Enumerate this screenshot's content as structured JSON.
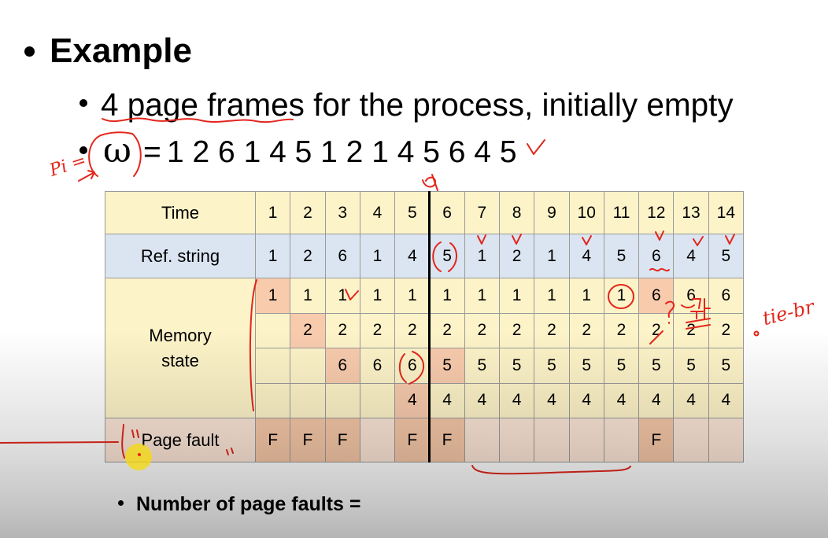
{
  "slide": {
    "heading": "Example",
    "bullet_frames": "4 page frames for the process, initially empty",
    "omega_symbol": "ω",
    "omega_equals": "=",
    "reference_string": "1 2 6 1 4 5 1 2 1 4 5 6 4 5",
    "question": "Number of page faults ="
  },
  "table": {
    "time_label": "Time",
    "times": [
      "1",
      "2",
      "3",
      "4",
      "5",
      "6",
      "7",
      "8",
      "9",
      "10",
      "11",
      "12",
      "13",
      "14"
    ],
    "ref_label": "Ref. string",
    "refs": [
      "1",
      "2",
      "6",
      "1",
      "4",
      "5",
      "1",
      "2",
      "1",
      "4",
      "5",
      "6",
      "4",
      "5"
    ],
    "memory_label": "Memory state",
    "frames": [
      [
        "1",
        "1",
        "1",
        "1",
        "1",
        "1",
        "1",
        "1",
        "1",
        "1",
        "1",
        "6",
        "6",
        "6"
      ],
      [
        "",
        "2",
        "2",
        "2",
        "2",
        "2",
        "2",
        "2",
        "2",
        "2",
        "2",
        "2",
        "2",
        "2"
      ],
      [
        "",
        "",
        "6",
        "6",
        "6",
        "5",
        "5",
        "5",
        "5",
        "5",
        "5",
        "5",
        "5",
        "5"
      ],
      [
        "",
        "",
        "",
        "",
        "4",
        "4",
        "4",
        "4",
        "4",
        "4",
        "4",
        "4",
        "4",
        "4"
      ]
    ],
    "loaded": [
      [
        1,
        0,
        0,
        0,
        0,
        0,
        0,
        0,
        0,
        0,
        0,
        1,
        0,
        0
      ],
      [
        0,
        1,
        0,
        0,
        0,
        0,
        0,
        0,
        0,
        0,
        0,
        0,
        0,
        0
      ],
      [
        0,
        0,
        1,
        0,
        0,
        1,
        0,
        0,
        0,
        0,
        0,
        0,
        0,
        0
      ],
      [
        0,
        0,
        0,
        0,
        1,
        0,
        0,
        0,
        0,
        0,
        0,
        0,
        0,
        0
      ]
    ],
    "fault_label": "Page fault",
    "faults": [
      "F",
      "F",
      "F",
      "",
      "F",
      "F",
      "",
      "",
      "",
      "",
      "",
      "F",
      "",
      ""
    ],
    "divider_after_time": 5
  },
  "annotations": {
    "pi_note": "Pi =",
    "tie_note": "tie-br"
  },
  "colors": {
    "text": "#000000",
    "header_bg": "#fdf3c8",
    "ref_bg": "#dbe5f1",
    "memory_bg": "#fdf3c8",
    "loaded_bg": "#f8cbad",
    "fault_row_bg": "#fbe5d6",
    "fault_mark_bg": "#f4c6a6",
    "grid_line": "#9a9a9a",
    "divider": "#000000",
    "ink": "#e3261c",
    "cursor": "#f5d90a"
  }
}
